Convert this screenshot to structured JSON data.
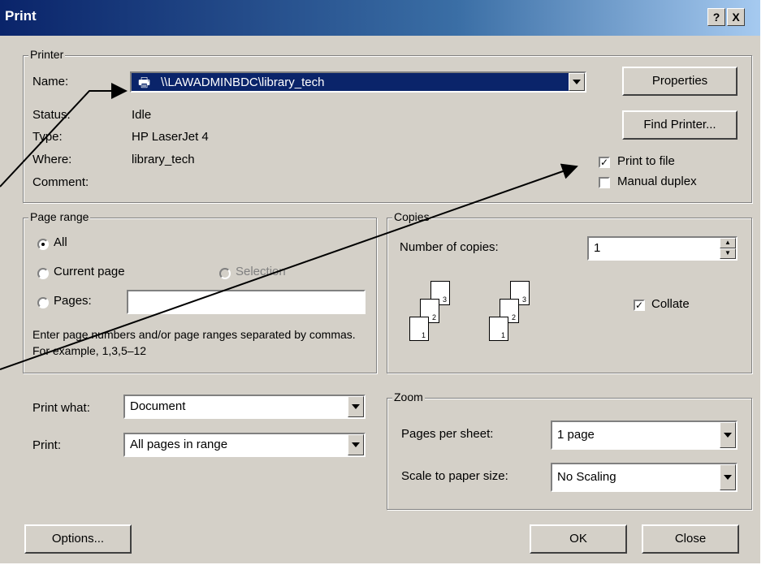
{
  "window": {
    "title": "Print",
    "help_label": "?",
    "close_label": "X"
  },
  "printer": {
    "group_label": "Printer",
    "name_label": "Name:",
    "name_value": "\\\\LAWADMINBDC\\library_tech",
    "status_label": "Status:",
    "status_value": "Idle",
    "type_label": "Type:",
    "type_value": "HP LaserJet 4",
    "where_label": "Where:",
    "where_value": "library_tech",
    "comment_label": "Comment:",
    "properties_label": "Properties",
    "find_printer_label": "Find Printer...",
    "print_to_file_label": "Print to file",
    "print_to_file_checked": true,
    "manual_duplex_label": "Manual duplex",
    "manual_duplex_checked": false
  },
  "page_range": {
    "group_label": "Page range",
    "all_label": "All",
    "current_page_label": "Current page",
    "selection_label": "Selection",
    "pages_label": "Pages:",
    "pages_value": "",
    "selected": "All",
    "hint": "Enter page numbers and/or page ranges separated by commas.  For example, 1,3,5–12"
  },
  "copies": {
    "group_label": "Copies",
    "number_label": "Number of copies:",
    "number_value": "1",
    "collate_label": "Collate",
    "collate_checked": true,
    "page_numbers": [
      "3",
      "2",
      "1"
    ]
  },
  "print_what": {
    "label": "Print what:",
    "value": "Document"
  },
  "print": {
    "label": "Print:",
    "value": "All pages in range"
  },
  "zoom": {
    "group_label": "Zoom",
    "pages_per_sheet_label": "Pages per sheet:",
    "pages_per_sheet_value": "1 page",
    "scale_label": "Scale to paper size:",
    "scale_value": "No Scaling"
  },
  "buttons": {
    "options": "Options...",
    "ok": "OK",
    "close": "Close"
  }
}
